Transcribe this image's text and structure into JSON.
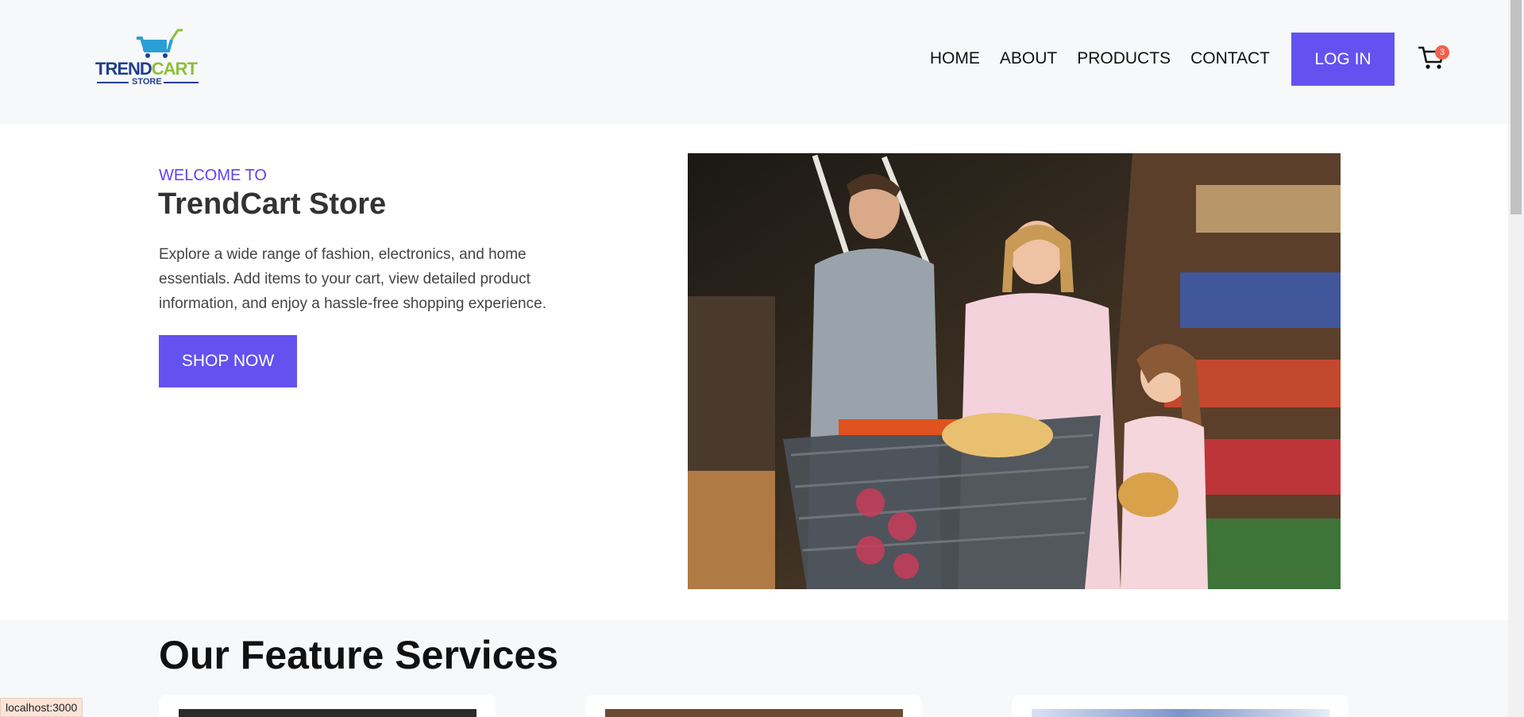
{
  "brand": {
    "name_part1": "TREND",
    "name_part2": "CART",
    "sub": "STORE"
  },
  "nav": {
    "items": [
      "HOME",
      "ABOUT",
      "PRODUCTS",
      "CONTACT"
    ],
    "login": "LOG IN",
    "cart_count": "3"
  },
  "hero": {
    "eyebrow": "WELCOME TO",
    "title": "TrendCart Store",
    "description": "Explore a wide range of fashion, electronics, and home essentials. Add items to your cart, view detailed product information, and enjoy a hassle-free shopping experience.",
    "cta": "SHOP NOW"
  },
  "services": {
    "title": "Our Feature Services"
  },
  "status": {
    "url": "localhost:3000"
  },
  "colors": {
    "accent": "#6352f0",
    "header_bg": "#f7f8fa",
    "badge": "#f0604d"
  }
}
